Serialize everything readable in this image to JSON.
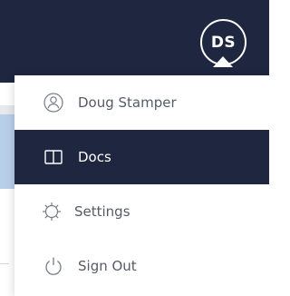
{
  "header": {
    "avatar_initials": "DS"
  },
  "menu": {
    "items": [
      {
        "label": "Doug Stamper",
        "icon": "user-icon",
        "active": false
      },
      {
        "label": "Docs",
        "icon": "book-icon",
        "active": true
      },
      {
        "label": "Settings",
        "icon": "gear-icon",
        "active": false
      },
      {
        "label": "Sign Out",
        "icon": "power-icon",
        "active": false
      }
    ]
  },
  "colors": {
    "navy": "#1e2640",
    "menu_text": "#555b66",
    "white": "#ffffff"
  }
}
